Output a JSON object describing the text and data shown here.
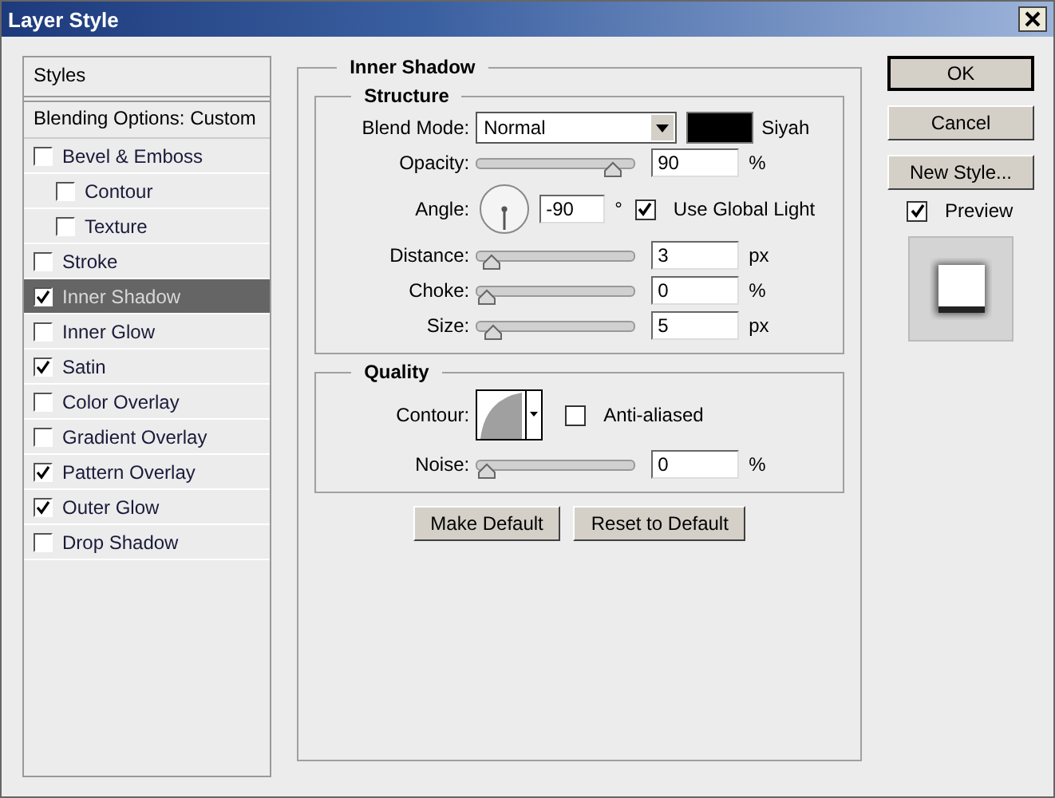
{
  "window": {
    "title": "Layer Style"
  },
  "sidebar": {
    "header": "Styles",
    "blending_options": "Blending Options: Custom",
    "effects": [
      {
        "label": "Bevel & Emboss",
        "checked": false,
        "selected": false,
        "children": [
          {
            "label": "Contour",
            "checked": false,
            "selected": false
          },
          {
            "label": "Texture",
            "checked": false,
            "selected": false
          }
        ]
      },
      {
        "label": "Stroke",
        "checked": false,
        "selected": false
      },
      {
        "label": "Inner Shadow",
        "checked": true,
        "selected": true
      },
      {
        "label": "Inner Glow",
        "checked": false,
        "selected": false
      },
      {
        "label": "Satin",
        "checked": true,
        "selected": false
      },
      {
        "label": "Color Overlay",
        "checked": false,
        "selected": false
      },
      {
        "label": "Gradient Overlay",
        "checked": false,
        "selected": false
      },
      {
        "label": "Pattern Overlay",
        "checked": true,
        "selected": false
      },
      {
        "label": "Outer Glow",
        "checked": true,
        "selected": false
      },
      {
        "label": "Drop Shadow",
        "checked": false,
        "selected": false
      }
    ]
  },
  "panel": {
    "title": "Inner Shadow",
    "structure": {
      "title": "Structure",
      "blend_mode": {
        "label": "Blend Mode:",
        "value": "Normal"
      },
      "color": {
        "color": "#000000",
        "label": "Siyah"
      },
      "rows": [
        {
          "kind": "slider",
          "label": "Opacity:",
          "level": 0.9,
          "value": "90",
          "unit": "%"
        },
        {
          "kind": "angle",
          "label": "Angle:",
          "value": "-90",
          "unit": "°",
          "option": {
            "label": "Use Global Light",
            "checked": true
          }
        },
        {
          "kind": "slider",
          "label": "Distance:",
          "level": 0.03,
          "value": "3",
          "unit": "px"
        },
        {
          "kind": "slider",
          "label": "Choke:",
          "level": 0,
          "value": "0",
          "unit": "%"
        },
        {
          "kind": "slider",
          "label": "Size:",
          "level": 0.05,
          "value": "5",
          "unit": "px"
        }
      ]
    },
    "quality": {
      "title": "Quality",
      "contour": {
        "label": "Contour:",
        "anti_aliased": {
          "label": "Anti-aliased",
          "checked": false
        }
      },
      "noise": {
        "label": "Noise:",
        "level": 0,
        "value": "0",
        "unit": "%"
      }
    },
    "buttons": [
      "Make Default",
      "Reset to Default"
    ]
  },
  "actions": [
    {
      "label": "OK",
      "default": true
    },
    {
      "label": "Cancel",
      "default": false
    },
    {
      "label": "New Style...",
      "default": false
    }
  ],
  "preview": {
    "label": "Preview",
    "checked": true
  }
}
